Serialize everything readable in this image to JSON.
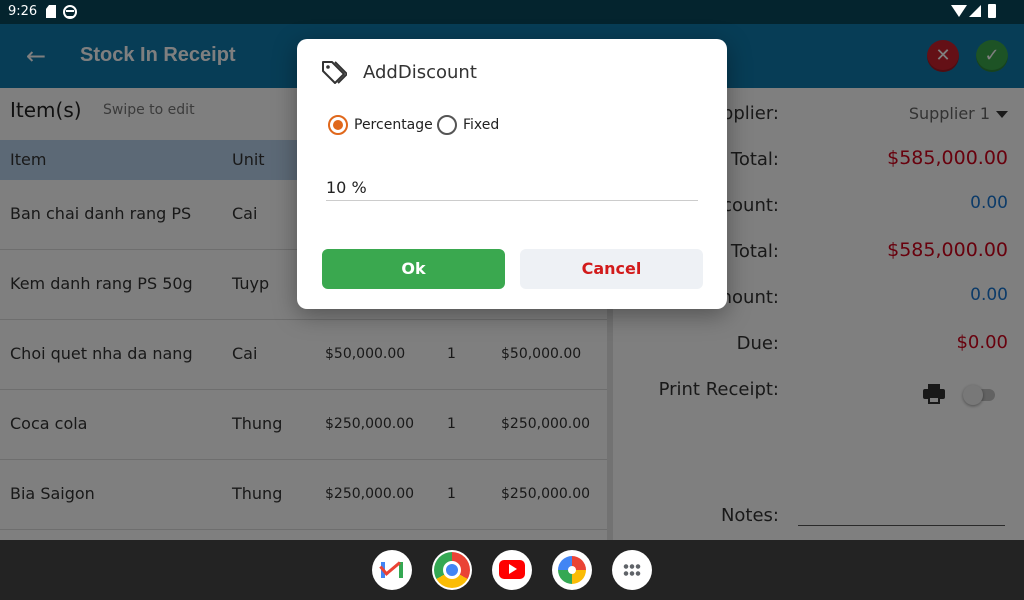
{
  "status_bar": {
    "time": "9:26"
  },
  "app_bar": {
    "title": "Stock In Receipt"
  },
  "items_panel": {
    "heading": "Item(s)",
    "hint": "Swipe to edit",
    "columns": [
      "Item",
      "Unit"
    ],
    "rows": [
      {
        "item": "Ban chai danh rang PS",
        "unit": "Cai",
        "price": "",
        "qty": "",
        "total": ""
      },
      {
        "item": "Kem danh rang PS 50g",
        "unit": "Tuyp",
        "price": "",
        "qty": "",
        "total": ""
      },
      {
        "item": "Choi quet nha da nang",
        "unit": "Cai",
        "price": "$50,000.00",
        "qty": "1",
        "total": "$50,000.00"
      },
      {
        "item": "Coca cola",
        "unit": "Thung",
        "price": "$250,000.00",
        "qty": "1",
        "total": "$250,000.00"
      },
      {
        "item": "Bia Saigon",
        "unit": "Thung",
        "price": "$250,000.00",
        "qty": "1",
        "total": "$250,000.00"
      }
    ]
  },
  "summary": {
    "supplier_label": "Supplier:",
    "supplier_value": "Supplier 1",
    "subtotal_label": "Sub Total:",
    "subtotal_value": "$585,000.00",
    "discount_label": "Discount:",
    "discount_value": "0.00",
    "total_label": "Total:",
    "total_value": "$585,000.00",
    "paid_label": "Paid Amount:",
    "paid_value": "0.00",
    "due_label": "Due:",
    "due_value": "$0.00",
    "print_label": "Print Receipt:",
    "notes_label": "Notes:"
  },
  "dialog": {
    "title": "AddDiscount",
    "option_percentage": "Percentage",
    "option_fixed": "Fixed",
    "selected_option": "Percentage",
    "value": "10 %",
    "ok_label": "Ok",
    "cancel_label": "Cancel"
  },
  "colors": {
    "app_bar": "#0e7aad",
    "ok_green": "#3aa84f",
    "cancel_red": "#d21b1b",
    "radio_accent": "#e0681c",
    "amount_red": "#d0021b",
    "amount_blue": "#1976d2"
  },
  "nav_apps": [
    "gmail-icon",
    "chrome-icon",
    "youtube-icon",
    "photos-icon",
    "app-drawer-icon"
  ]
}
